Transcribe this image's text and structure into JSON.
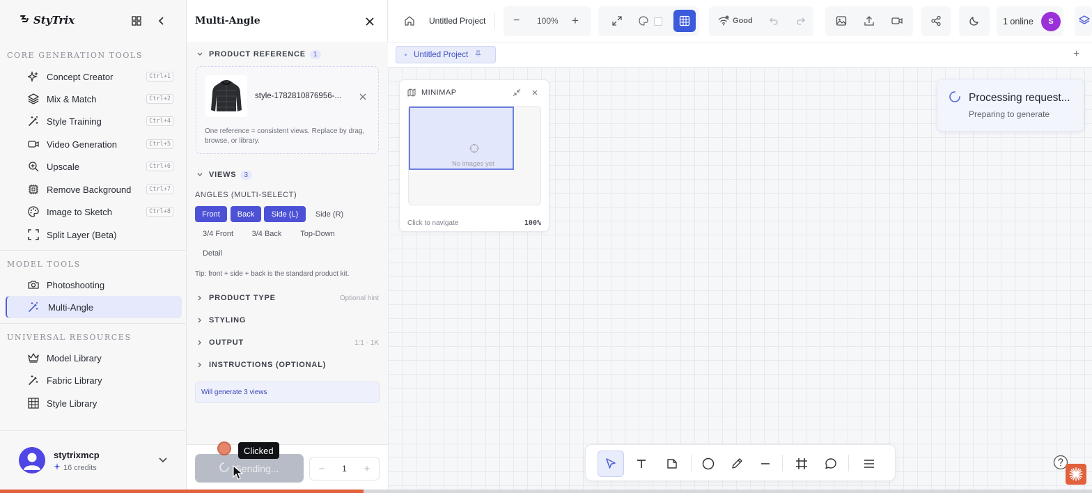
{
  "app": {
    "brand": "StyTrix"
  },
  "sidebar": {
    "sections": {
      "core": "CORE GENERATION TOOLS",
      "model": "MODEL TOOLS",
      "resources": "UNIVERSAL RESOURCES"
    },
    "core_items": [
      {
        "label": "Concept Creator",
        "shortcut": "Ctrl+1",
        "icon": "sparkles-icon"
      },
      {
        "label": "Mix & Match",
        "shortcut": "Ctrl+2",
        "icon": "layers-icon"
      },
      {
        "label": "Style Training",
        "shortcut": "Ctrl+4",
        "icon": "magic-wand-icon"
      },
      {
        "label": "Video Generation",
        "shortcut": "Ctrl+5",
        "icon": "video-icon"
      },
      {
        "label": "Upscale",
        "shortcut": "Ctrl+6",
        "icon": "zoom-in-icon"
      },
      {
        "label": "Remove Background",
        "shortcut": "Ctrl+7",
        "icon": "chip-icon"
      },
      {
        "label": "Image to Sketch",
        "shortcut": "Ctrl+8",
        "icon": "palette-icon"
      },
      {
        "label": "Split Layer (Beta)",
        "icon": "frame-corners-icon"
      }
    ],
    "model_items": [
      {
        "label": "Photoshooting",
        "icon": "camera-icon"
      },
      {
        "label": "Multi-Angle",
        "icon": "magic-wand-icon",
        "active": true
      }
    ],
    "resource_items": [
      {
        "label": "Model Library",
        "icon": "crown-icon"
      },
      {
        "label": "Fabric Library",
        "icon": "magic-wand-icon"
      },
      {
        "label": "Style Library",
        "icon": "grid-icon"
      }
    ],
    "user": {
      "name": "stytrixmcp",
      "credits": "16 credits"
    }
  },
  "panel": {
    "title": "Multi-Angle",
    "product_reference": {
      "label": "PRODUCT REFERENCE",
      "count": "1",
      "file_name": "style-1782810876956-...",
      "note": "One reference = consistent views. Replace by drag, browse, or library."
    },
    "views": {
      "label": "VIEWS",
      "count": "3"
    },
    "angles_label": "ANGLES (MULTI-SELECT)",
    "angles": [
      {
        "label": "Front",
        "selected": true
      },
      {
        "label": "Back",
        "selected": true
      },
      {
        "label": "Side (L)",
        "selected": true
      },
      {
        "label": "Side (R)",
        "selected": false
      },
      {
        "label": "3/4 Front",
        "selected": false
      },
      {
        "label": "3/4 Back",
        "selected": false
      },
      {
        "label": "Top-Down",
        "selected": false
      },
      {
        "label": "Detail",
        "selected": false
      }
    ],
    "tip": "Tip: front + side + back is the standard product kit.",
    "product_type": {
      "label": "PRODUCT TYPE",
      "hint": "Optional hint"
    },
    "styling": {
      "label": "STYLING"
    },
    "output": {
      "label": "OUTPUT",
      "hint": "1:1 · 1K"
    },
    "instructions": {
      "label": "INSTRUCTIONS (OPTIONAL)"
    },
    "generate_summary": "Will generate 3 views",
    "send_label": "Sending...",
    "quantity": "1",
    "stepper_minus": "−",
    "stepper_plus": "+"
  },
  "overlay": {
    "tooltip": "Clicked"
  },
  "topbar": {
    "project_title": "Untitled Project",
    "zoom_minus": "−",
    "zoom": "100%",
    "zoom_plus": "+",
    "connection": "Good",
    "online": "1 online",
    "avatar_letter": "S"
  },
  "tabs": {
    "project_tab": "Untitled Project",
    "add": "+"
  },
  "minimap": {
    "title": "MINIMAP",
    "empty": "No images yet",
    "hint": "Click to navigate",
    "zoom": "100%"
  },
  "toast": {
    "title": "Processing request...",
    "subtitle": "Preparing to generate"
  },
  "progress": {
    "fraction": 0.333
  },
  "colors": {
    "accent": "#4c51d6",
    "brand_orange": "#e0613c",
    "avatar_purple": "#9b30d9"
  }
}
